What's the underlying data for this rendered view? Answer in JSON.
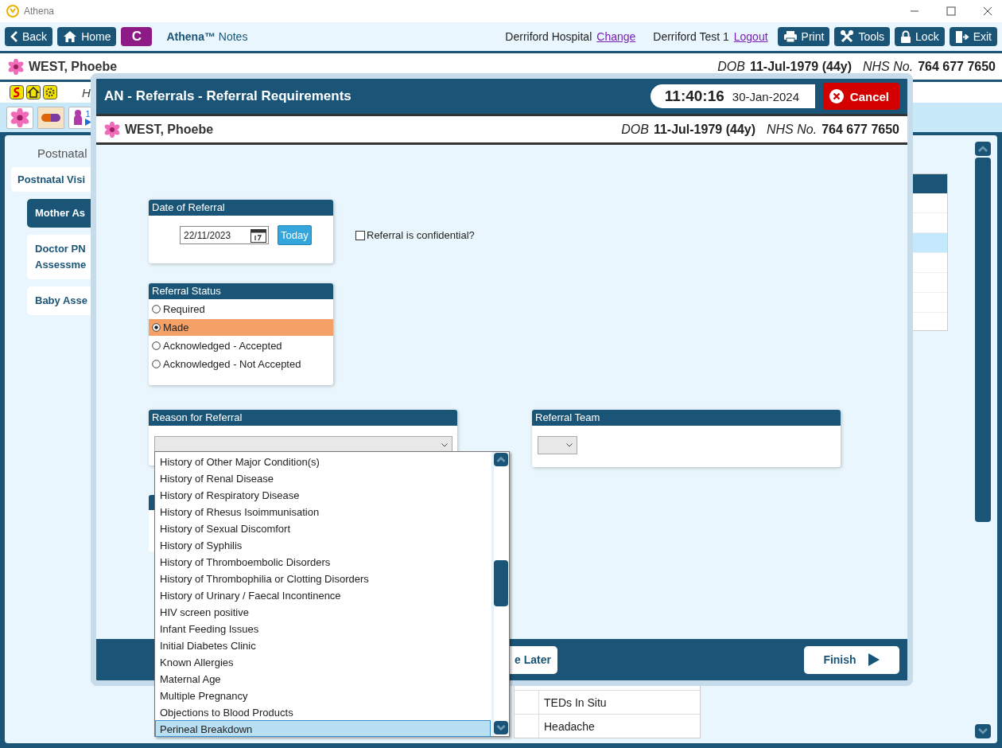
{
  "window": {
    "title": "Athena"
  },
  "toolbar": {
    "buttons": [
      {
        "kind": "back",
        "label": "Back"
      },
      {
        "kind": "home",
        "label": "Home"
      },
      {
        "kind": "app",
        "label": "C"
      }
    ],
    "app_name": "**Athena™** Notes",
    "location": "Derriford Hospital",
    "change_link": "Change",
    "user": "Derriford Test 1",
    "logout_link": "Logout",
    "actions": [
      {
        "kind": "print",
        "label": "Print"
      },
      {
        "kind": "tools",
        "label": "Tools"
      },
      {
        "kind": "lock",
        "label": "Lock"
      },
      {
        "kind": "exit",
        "label": "Exit"
      }
    ]
  },
  "patient": {
    "name": "WEST, Phoebe",
    "dob_label": "DOB",
    "dob": "11-Jul-1979 (44y)",
    "nhs_label": "NHS No.",
    "nhs": "764 677 7650"
  },
  "hint_text": "H",
  "quick_badge": "1",
  "nav": {
    "heading": "Postnatal",
    "items": [
      {
        "label": "Postnatal Visi",
        "selected": false,
        "children": [
          {
            "label": "Mother As",
            "selected": true
          },
          {
            "label": "Doctor PN Assessme",
            "selected": false
          },
          {
            "label": "Baby Asse",
            "selected": false
          }
        ]
      }
    ]
  },
  "background_table": {
    "rows": [
      {
        "column_2": "TEDs In Situ"
      },
      {
        "column_2": "Headache"
      }
    ]
  },
  "modal": {
    "title": "AN - Referrals - Referral Requirements",
    "time": "11:40:16",
    "date": "30-Jan-2024",
    "cancel": "Cancel",
    "patient": {
      "name": "WEST, Phoebe",
      "dob_label": "DOB",
      "dob": "11-Jul-1979 (44y)",
      "nhs_label": "NHS No.",
      "nhs": "764 677 7650"
    },
    "date_of_referral": {
      "title": "Date of Referral",
      "value": "22/11/2023",
      "today": "Today"
    },
    "confidential": {
      "label": "Referral is confidential?",
      "checked": false
    },
    "status": {
      "title": "Referral Status",
      "options": [
        {
          "label": "Required",
          "selected": false
        },
        {
          "label": "Made",
          "selected": true
        },
        {
          "label": "Acknowledged - Accepted",
          "selected": false
        },
        {
          "label": "Acknowledged - Not Accepted",
          "selected": false
        }
      ]
    },
    "reason": {
      "title": "Reason for Referral",
      "options": [
        {
          "label": "History of Other Major Condition(s)",
          "selected": false
        },
        {
          "label": "History of Renal Disease",
          "selected": false
        },
        {
          "label": "History of Respiratory Disease",
          "selected": false
        },
        {
          "label": "History of Rhesus Isoimmunisation",
          "selected": false
        },
        {
          "label": "History of Sexual Discomfort",
          "selected": false
        },
        {
          "label": "History of Syphilis",
          "selected": false
        },
        {
          "label": "History of Thromboembolic Disorders",
          "selected": false
        },
        {
          "label": "History of Thrombophilia or Clotting Disorders",
          "selected": false
        },
        {
          "label": "History of Urinary / Faecal Incontinence",
          "selected": false
        },
        {
          "label": "HIV screen positive",
          "selected": false
        },
        {
          "label": "Infant Feeding Issues",
          "selected": false
        },
        {
          "label": "Initial Diabetes Clinic",
          "selected": false
        },
        {
          "label": "Known Allergies",
          "selected": false
        },
        {
          "label": "Maternal Age",
          "selected": false
        },
        {
          "label": "Multiple Pregnancy",
          "selected": false
        },
        {
          "label": "Objections to Blood Products",
          "selected": false
        },
        {
          "label": "Perineal Breakdown",
          "selected": true
        }
      ]
    },
    "team": {
      "title": "Referral Team"
    },
    "footer": {
      "later": "e Later",
      "finish": "Finish"
    }
  }
}
